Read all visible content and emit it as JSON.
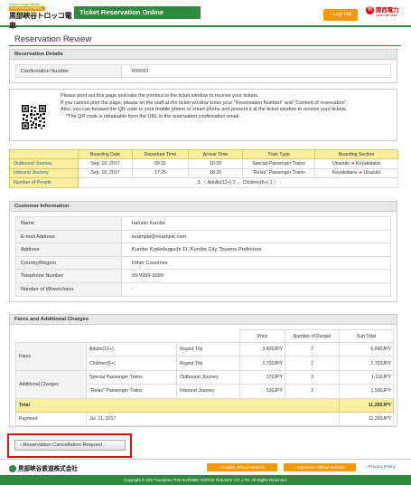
{
  "header": {
    "logo_tagline_top": "Kurobe Gorge Railway",
    "logo_tagline_badge": "Kurobe Gorge Railway",
    "logo_name": "黒部峡谷トロッコ電車",
    "site_title": "Ticket Reservation Online",
    "logout_label": "Log out",
    "partner_mark": "関",
    "partner_name": "関西電力",
    "partner_tagline": "power with heart"
  },
  "page": {
    "title": "Reservation Review"
  },
  "reservation_details": {
    "heading": "Reservation Details",
    "confirmation_label": "Confirmation Number",
    "confirmation_value": "600001"
  },
  "qr_notice": {
    "lines": [
      "Please print out this page and take the printout to the ticket window to receive your tickets.",
      "If you cannot print the page, please let the staff at the ticket window know your \"Reservation Number\" and \"Content of reservation\".",
      "Also, you can forward the QR code to your mobile phone or smart phone and present it at the ticket window to receive your tickets.",
      "*The QR code is obtainable from the URL in the reservation confirmation email."
    ]
  },
  "journey_table": {
    "headers": [
      "",
      "Boarding Date",
      "Departure Time",
      "Arrival Time",
      "Train Type",
      "Boarding Section"
    ],
    "rows": [
      {
        "label": "Outbound Journey",
        "date": "Sep. 10, 2017",
        "depart": "09:21",
        "arrive": "10:39",
        "train": "Special Passenger Trains",
        "from": "Unazuki",
        "to": "Keyakidaira"
      },
      {
        "label": "Inbound Journey",
        "date": "Sep. 10, 2017",
        "depart": "17:25",
        "arrive": "18:39",
        "train": "\"Relax\" Passenger Trains",
        "from": "Keyakidaira",
        "to": "Unazuki"
      }
    ],
    "people_label": "Number of People",
    "people_value": "3 （ Adults(12+) 2 ， Children(6+) 1 ）"
  },
  "customer": {
    "heading": "Customer Information",
    "fields": [
      {
        "label": "Name",
        "value": "hanako kurobe"
      },
      {
        "label": "E-mail Address",
        "value": "example@example.com"
      },
      {
        "label": "Address",
        "value": "Kurobe Kyokokuguchi 11, Kurobe City, Toyama Prefecture"
      },
      {
        "label": "Country/Region",
        "value": "Other Countries"
      },
      {
        "label": "Telephone Number",
        "value": "99-9999-9999"
      },
      {
        "label": "Number of Wheelchairs",
        "value": "-"
      }
    ]
  },
  "fares": {
    "heading": "Fares and Additional Charges",
    "col_price": "Price",
    "col_people": "Number of People",
    "col_subtotal": "Sub Total",
    "fares_label": "Fares",
    "additional_label": "Additional Charges",
    "rows": [
      {
        "item": "Adults(12+)",
        "type": "Round Trip",
        "price": "3,420JPY",
        "people": "2",
        "subtotal": "6,840JPY"
      },
      {
        "item": "Children(6+)",
        "type": "Round Trip",
        "price": "1,720JPY",
        "people": "1",
        "subtotal": "1,720JPY"
      },
      {
        "item": "Special Passenger Trains",
        "type": "Outbound Journey",
        "price": "370JPY",
        "people": "3",
        "subtotal": "1,110JPY"
      },
      {
        "item": "\"Relax\" Passenger Trains",
        "type": "Inbound Journey",
        "price": "530JPY",
        "people": "3",
        "subtotal": "1,590JPY"
      }
    ],
    "total_label": "Total",
    "total_value": "11,260JPY",
    "payment_label": "Payment",
    "payment_date": "Jul. 11, 2017",
    "payment_value": "11,260JPY"
  },
  "actions": {
    "cancel_label": "Reservation Cancellation Request"
  },
  "footer": {
    "company": "黒部峡谷鉄道株式会社",
    "english_site": "English Official Website",
    "japanese_site": "Japanese Official Website",
    "privacy": "Privacy Policy",
    "copyright": "Copyright © 2017 kurotetsu THE KUROBE GORGE RAILWAY CO.,LTD. All Rights Reserved."
  },
  "colors": {
    "brand_green": "#2e8b3e",
    "accent_orange": "#f39800",
    "table_yellow": "#f9ef9f",
    "highlight_red": "#e01010"
  }
}
